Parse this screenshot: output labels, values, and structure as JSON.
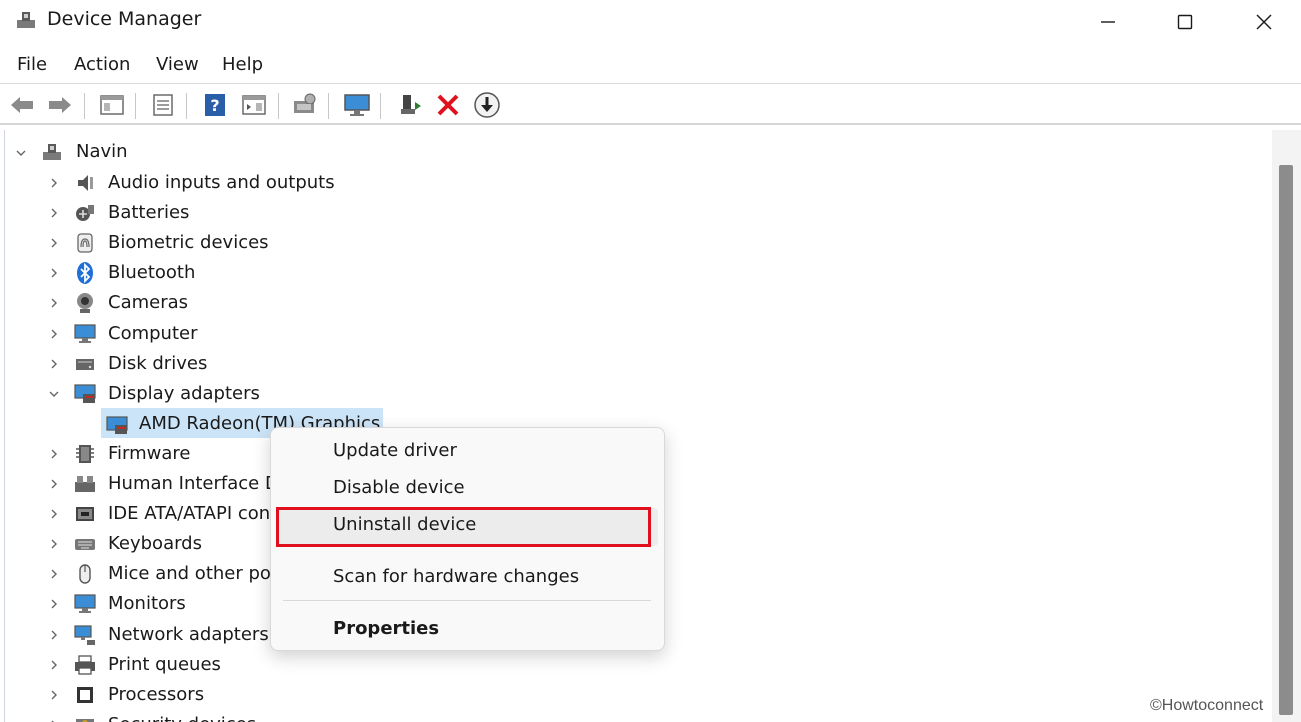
{
  "window": {
    "title": "Device Manager",
    "controls": [
      "minimize",
      "maximize",
      "close"
    ]
  },
  "menubar": {
    "items": [
      "File",
      "Action",
      "View",
      "Help"
    ]
  },
  "toolbar": {
    "buttons": [
      "back-icon",
      "forward-icon",
      "show-hide-console-tree-icon",
      "properties-icon",
      "help-icon",
      "action-pane-icon",
      "scan-hardware-icon",
      "display-icon",
      "update-driver-icon",
      "uninstall-device-icon",
      "download-icon"
    ]
  },
  "tree": {
    "root": "Navin",
    "categories": [
      {
        "label": "Audio inputs and outputs",
        "icon": "speaker-icon"
      },
      {
        "label": "Batteries",
        "icon": "battery-icon"
      },
      {
        "label": "Biometric devices",
        "icon": "fingerprint-icon"
      },
      {
        "label": "Bluetooth",
        "icon": "bluetooth-icon"
      },
      {
        "label": "Cameras",
        "icon": "camera-icon"
      },
      {
        "label": "Computer",
        "icon": "monitor-icon"
      },
      {
        "label": "Disk drives",
        "icon": "disk-icon"
      },
      {
        "label": "Display adapters",
        "icon": "display-adapter-icon",
        "expanded": true
      },
      {
        "label": "Firmware",
        "icon": "firmware-icon"
      },
      {
        "label": "Human Interface D",
        "icon": "hid-icon"
      },
      {
        "label": "IDE ATA/ATAPI contr",
        "icon": "ide-icon"
      },
      {
        "label": "Keyboards",
        "icon": "keyboard-icon"
      },
      {
        "label": "Mice and other po",
        "icon": "mouse-icon"
      },
      {
        "label": "Monitors",
        "icon": "monitor-icon"
      },
      {
        "label": "Network adapters",
        "icon": "network-icon"
      },
      {
        "label": "Print queues",
        "icon": "printer-icon"
      },
      {
        "label": "Processors",
        "icon": "processor-icon"
      },
      {
        "label": "Security devices",
        "icon": "security-icon"
      }
    ],
    "selected_child": "AMD Radeon(TM) Graphics"
  },
  "context_menu": {
    "items": [
      "Update driver",
      "Disable device",
      "Uninstall device",
      "Scan for hardware changes",
      "Properties"
    ],
    "highlighted": "Uninstall device",
    "highlight_color": "#e0101e"
  },
  "watermark": "©Howtoconnect",
  "colors": {
    "selection": "#cce4f7",
    "accent_red": "#e0101e"
  }
}
